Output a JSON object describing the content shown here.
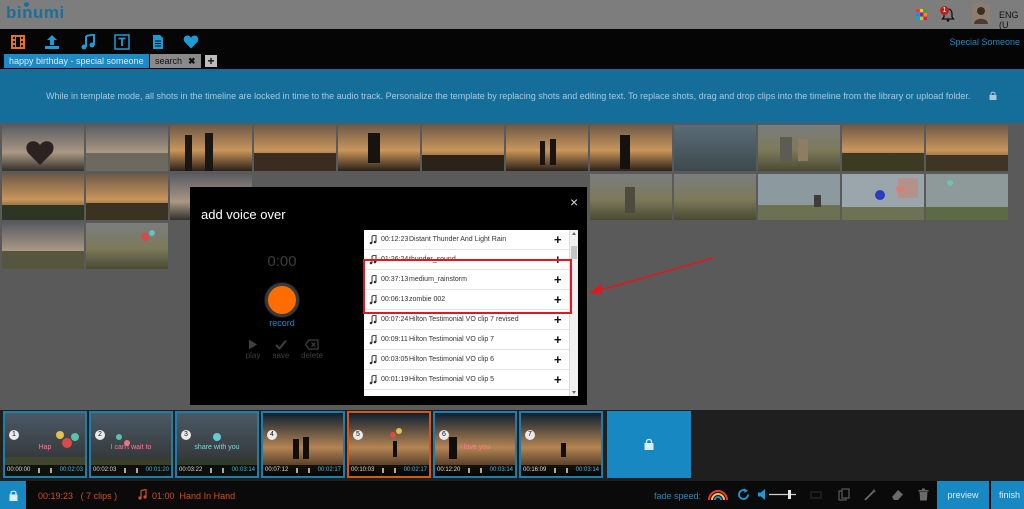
{
  "app": {
    "logo_text": "binumi",
    "language": "ENG (U",
    "notification_count": "1"
  },
  "toolbar": {
    "user_name": "Special Someone",
    "tabs": [
      {
        "label": "happy birthday - special someone"
      },
      {
        "label": "search",
        "close": "✖"
      }
    ],
    "add_tab": "+"
  },
  "banner": {
    "text": "While in template mode, all shots in the timeline are locked in time to the audio track. Personalize the template by replacing shots and editing text. To replace shots, drag and drop clips into the timeline from the library or upload folder."
  },
  "modal": {
    "title": "add voice over",
    "close": "×",
    "timer": "0:00",
    "record_label": "record",
    "controls": [
      {
        "label": "play"
      },
      {
        "label": "save"
      },
      {
        "label": "delete"
      }
    ],
    "tracks": [
      {
        "duration": "00:12:23",
        "name": "Distant Thunder And Light Rain"
      },
      {
        "duration": "01:26:24",
        "name": "thunder_sound"
      },
      {
        "duration": "00:37:13",
        "name": "medium_rainstorm"
      },
      {
        "duration": "00:06:13",
        "name": "zombie 002"
      },
      {
        "duration": "00:07:24",
        "name": "Hilton Testimonial VO clip 7 revised"
      },
      {
        "duration": "00:09:11",
        "name": "Hilton Testimonial VO clip 7"
      },
      {
        "duration": "00:03:05",
        "name": "Hilton Testimonial VO clip 6"
      },
      {
        "duration": "00:01:19",
        "name": "Hilton Testimonial VO clip 5"
      }
    ],
    "add_symbol": "+"
  },
  "storyboard": {
    "shots": [
      {
        "num": "1",
        "caption": "Hap",
        "start": "00:00:00",
        "length": "00:02:03"
      },
      {
        "num": "2",
        "caption": "I can't wait to",
        "start": "00:02:03",
        "length": "00:01:20"
      },
      {
        "num": "3",
        "caption": "share with you",
        "start": "00:03:22",
        "length": "00:03:14"
      },
      {
        "num": "4",
        "caption": "",
        "start": "00:07:12",
        "length": "00:02:17"
      },
      {
        "num": "5",
        "caption": "",
        "start": "00:10:03",
        "length": "00:02:17"
      },
      {
        "num": "6",
        "caption": "I love you",
        "start": "00:12:20",
        "length": "00:03:14"
      },
      {
        "num": "7",
        "caption": "",
        "start": "00:16:09",
        "length": "00:03:14"
      }
    ]
  },
  "bottombar": {
    "duration": "00:19:23",
    "clips": "( 7 clips )",
    "track_time": "01:00",
    "track_name": "Hand In Hand",
    "fade_label": "fade speed:",
    "preview": "preview",
    "finish": "finish"
  },
  "colors": {
    "accent": "#1788c2",
    "record": "#ff6d00",
    "warning": "#d64b20",
    "highlight": "#e0191f"
  },
  "icons": [
    "film-icon",
    "upload-icon",
    "music-icon",
    "text-icon",
    "document-icon",
    "heart-icon",
    "grid-icon",
    "bell-icon",
    "lock-icon",
    "note-icon",
    "plus-icon",
    "close-icon",
    "play-icon",
    "check-icon",
    "delete-icon",
    "refresh-icon",
    "volume-icon"
  ]
}
